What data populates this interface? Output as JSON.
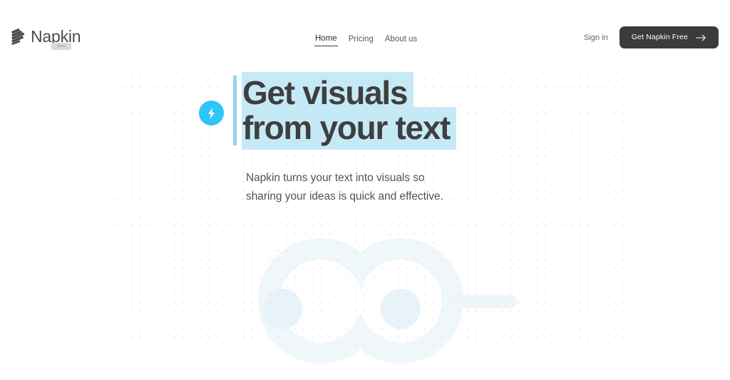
{
  "brand": {
    "name": "Napkin",
    "badge_label": "beta",
    "logo_icon": "napkin-stripes-logo"
  },
  "nav": {
    "items": [
      {
        "label": "Home",
        "active": true
      },
      {
        "label": "Pricing",
        "active": false
      },
      {
        "label": "About us",
        "active": false
      }
    ]
  },
  "actions": {
    "signin_label": "Sign in",
    "cta_label": "Get Napkin Free",
    "cta_icon": "arrow-right-icon"
  },
  "hero": {
    "badge_icon": "lightning-bolt-icon",
    "headline_line1": "Get visuals",
    "headline_line2": "from your text",
    "subtitle": "Napkin turns your text into visuals so sharing your ideas is quick and effective."
  },
  "background": {
    "watermark_icon": "faint-node-diagram-watermark",
    "dot_grid_icon": "dot-grid-pattern"
  },
  "colors": {
    "page_bg": "#ffffff",
    "highlight": "#c6e9f6",
    "highlight_bar": "#8ad8ef",
    "accent_cyan": "#2ec5f7",
    "cta_bg": "#3b3b3b",
    "text_dark": "#3f3f3f",
    "text_muted": "#54585f",
    "dot_grid": "#d8dce4",
    "watermark": "#eef6fa"
  }
}
